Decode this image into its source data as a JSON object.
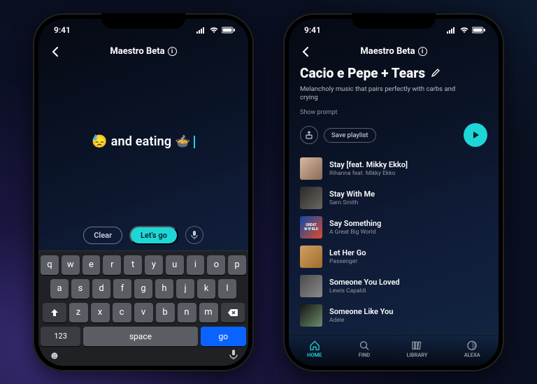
{
  "status": {
    "time": "9:41"
  },
  "header": {
    "title": "Maestro Beta"
  },
  "left": {
    "input_text": "😓 and eating 🍲",
    "clear": "Clear",
    "go": "Let's go",
    "num_key": "123",
    "space_key": "space",
    "go_key": "go",
    "rows": {
      "r1": [
        "q",
        "w",
        "e",
        "r",
        "t",
        "y",
        "u",
        "i",
        "o",
        "p"
      ],
      "r2": [
        "a",
        "s",
        "d",
        "f",
        "g",
        "h",
        "j",
        "k",
        "l"
      ],
      "r3": [
        "z",
        "x",
        "c",
        "v",
        "b",
        "n",
        "m"
      ]
    }
  },
  "right": {
    "title": "Cacio e Pepe + Tears",
    "description": "Melancholy music that pairs perfectly with carbs and crying",
    "show_prompt": "Show prompt",
    "save": "Save playlist",
    "tracks": [
      {
        "name": "Stay [feat. Mikky Ekko]",
        "artist": "Rihanna feat. Mikky Ekko"
      },
      {
        "name": "Stay With Me",
        "artist": "Sam Smith"
      },
      {
        "name": "Say Something",
        "artist": "A Great Big World"
      },
      {
        "name": "Let Her Go",
        "artist": "Passenger"
      },
      {
        "name": "Someone You Loved",
        "artist": "Lewis Capaldi"
      },
      {
        "name": "Someone Like You",
        "artist": "Adele"
      }
    ],
    "nav": {
      "home": "HOME",
      "find": "FIND",
      "library": "LIBRARY",
      "alexa": "ALEXA"
    }
  }
}
